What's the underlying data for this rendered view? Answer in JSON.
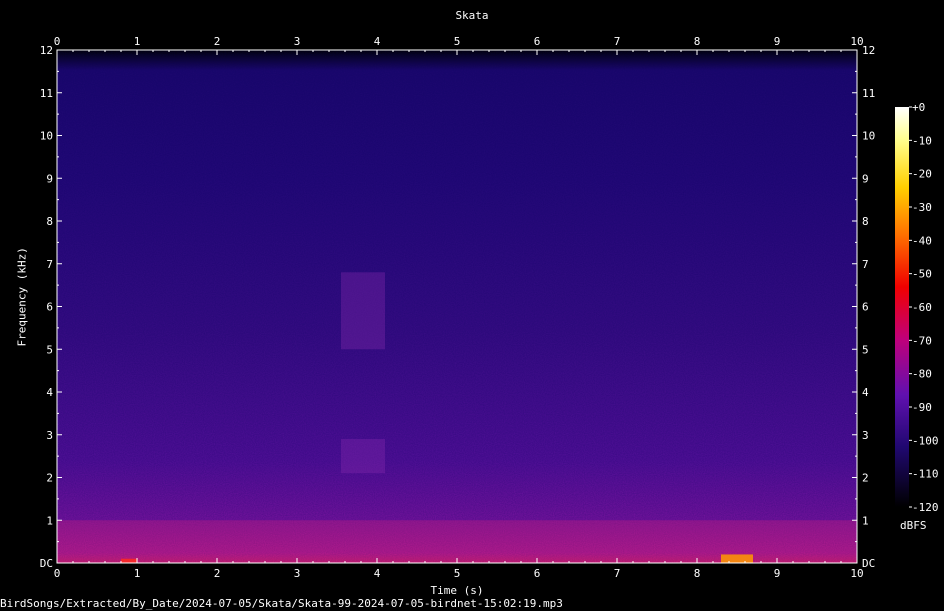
{
  "chart_data": {
    "type": "heatmap",
    "title": "Skata",
    "xlabel": "Time (s)",
    "ylabel": "Frequency (kHz)",
    "xlim": [
      0,
      10
    ],
    "ylim": [
      0,
      12
    ],
    "x_ticks": [
      "0",
      "1",
      "2",
      "3",
      "4",
      "5",
      "6",
      "7",
      "8",
      "9",
      "10"
    ],
    "y_ticks": [
      "DC",
      "1",
      "2",
      "3",
      "4",
      "5",
      "6",
      "7",
      "8",
      "9",
      "10",
      "11",
      "12"
    ],
    "colorbar": {
      "unit": "dBFS",
      "range": [
        -120,
        0
      ],
      "ticks": [
        "+0",
        "-10",
        "-20",
        "-30",
        "-40",
        "-50",
        "-60",
        "-70",
        "-80",
        "-90",
        "-100",
        "-110",
        "-120"
      ]
    },
    "energy_regions": [
      {
        "t": [
          0,
          10
        ],
        "f": [
          0,
          1.0
        ],
        "level_dbfs": -75
      },
      {
        "t": [
          3.55,
          4.1
        ],
        "f": [
          2.1,
          2.9
        ],
        "level_dbfs": -85
      },
      {
        "t": [
          3.55,
          4.1
        ],
        "f": [
          5.0,
          6.8
        ],
        "level_dbfs": -88
      },
      {
        "t": [
          8.3,
          8.7
        ],
        "f": [
          0,
          0.2
        ],
        "level_dbfs": -35
      },
      {
        "t": [
          0.8,
          1.0
        ],
        "f": [
          0,
          0.1
        ],
        "level_dbfs": -45
      }
    ]
  },
  "footer": {
    "filename": "BirdSongs/Extracted/By_Date/2024-07-05/Skata/Skata-99-2024-07-05-birdnet-15:02:19.mp3"
  }
}
